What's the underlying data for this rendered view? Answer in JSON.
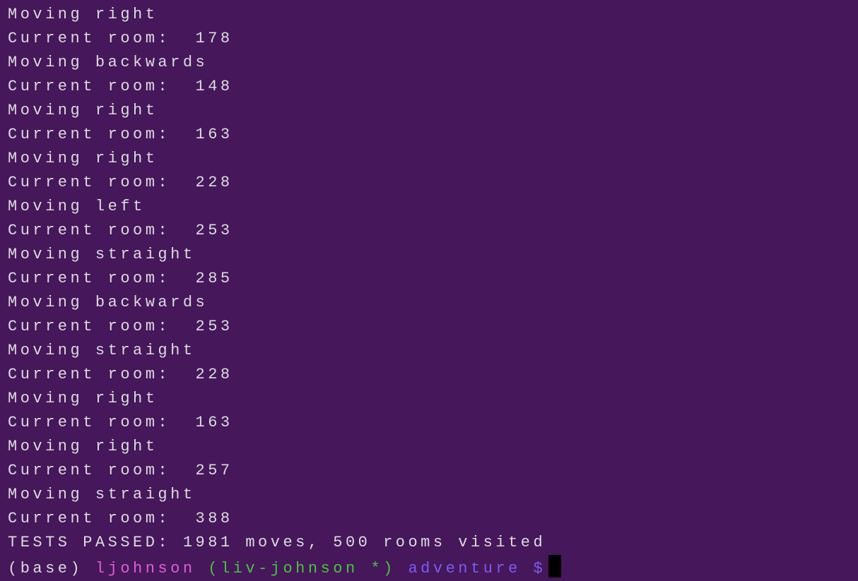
{
  "terminal": {
    "lines": [
      "Moving right",
      "Current room:  178",
      "Moving backwards",
      "Current room:  148",
      "Moving right",
      "Current room:  163",
      "Moving right",
      "Current room:  228",
      "Moving left",
      "Current room:  253",
      "Moving straight",
      "Current room:  285",
      "Moving backwards",
      "Current room:  253",
      "Moving straight",
      "Current room:  228",
      "Moving right",
      "Current room:  163",
      "Moving right",
      "Current room:  257",
      "Moving straight",
      "Current room:  388",
      "TESTS PASSED: 1981 moves, 500 rooms visited"
    ],
    "prompt": {
      "env": "(base) ",
      "user": "ljohnson ",
      "branch": "(liv-johnson *) ",
      "dir": "adventure $"
    }
  },
  "colors": {
    "background": "#46175b",
    "text": "#dcdcdc",
    "user": "#e35bd6",
    "branch": "#46c43e",
    "dir": "#7b5cf2"
  }
}
